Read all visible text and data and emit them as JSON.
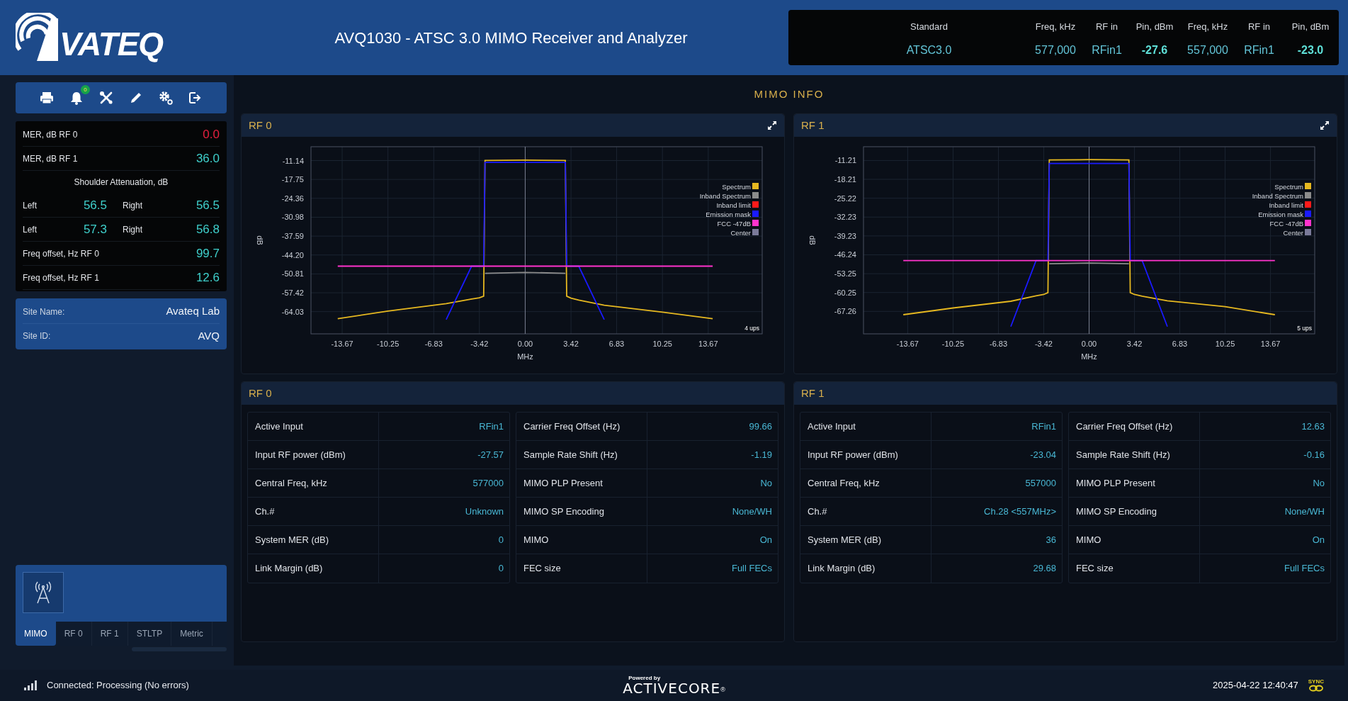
{
  "header": {
    "logo_text": "VATEQ",
    "title": "AVQ1030 - ATSC 3.0 MIMO Receiver and Analyzer",
    "summary": {
      "columns": [
        "Standard",
        "Freq, kHz",
        "RF in",
        "Pin, dBm",
        "Freq, kHz",
        "RF in",
        "Pin, dBm"
      ],
      "values": [
        "ATSC3.0",
        "577,000",
        "RFin1",
        "-27.6",
        "557,000",
        "RFin1",
        "-23.0"
      ]
    }
  },
  "toolbar": {
    "notification_count": "0"
  },
  "metrics": [
    {
      "kind": "single",
      "label": "MER, dB RF 0",
      "value": "0.0",
      "alarm": true
    },
    {
      "kind": "single",
      "label": "MER, dB RF 1",
      "value": "36.0",
      "alarm": false
    },
    {
      "kind": "heading",
      "label": "Shoulder Attenuation, dB"
    },
    {
      "kind": "pair",
      "label": "Left",
      "value": "56.5",
      "label2": "Right",
      "value2": "56.5"
    },
    {
      "kind": "pair",
      "label": "Left",
      "value": "57.3",
      "label2": "Right",
      "value2": "56.8"
    },
    {
      "kind": "single",
      "label": "Freq offset, Hz RF 0",
      "value": "99.7",
      "alarm": false
    },
    {
      "kind": "single",
      "label": "Freq offset, Hz RF 1",
      "value": "12.6",
      "alarm": false
    }
  ],
  "site": [
    {
      "label": "Site Name:",
      "value": "Avateq Lab"
    },
    {
      "label": "Site ID:",
      "value": "AVQ"
    }
  ],
  "nav_tabs": [
    {
      "label": "MIMO",
      "selected": true
    },
    {
      "label": "RF 0",
      "selected": false
    },
    {
      "label": "RF 1",
      "selected": false
    },
    {
      "label": "STLTP",
      "selected": false
    },
    {
      "label": "Metric",
      "selected": false
    }
  ],
  "main_title": "MIMO INFO",
  "spectrum_panels": [
    {
      "title": "RF 0",
      "rate": "4 ups",
      "chart_data": {
        "type": "line",
        "xlabel": "MHz",
        "ylabel": "dB",
        "x": [
          -14,
          -10.25,
          -5.9,
          -4.0,
          -3.42,
          -3.1,
          -3.0,
          0,
          3.0,
          3.1,
          3.42,
          4.0,
          5.9,
          10.25,
          14
        ],
        "series": [
          {
            "name": "Spectrum",
            "color": "#e6b820",
            "values": [
              -66.5,
              -63.8,
              -61.2,
              -59.6,
              -59.2,
              -58.6,
              -11.1,
              -11.0,
              -11.1,
              -58.6,
              -59.3,
              -60.0,
              -61.8,
              -64.2,
              -66.5
            ]
          },
          {
            "name": "Inband Spectrum",
            "color": "#8c8c8c",
            "values": [
              null,
              null,
              null,
              null,
              null,
              null,
              -50.6,
              -50.3,
              -50.6,
              null,
              null,
              null,
              null,
              null,
              null
            ]
          },
          {
            "name": "Inband limit",
            "color": "#ff1a1a",
            "values": [
              null,
              null,
              null,
              null,
              null,
              null,
              null,
              null,
              null,
              null,
              null,
              null,
              null,
              null,
              null
            ]
          },
          {
            "name": "Emission mask",
            "color": "#1a1aff",
            "values": [
              null,
              null,
              -66.8,
              -48.1,
              -48.1,
              -48.1,
              -11.8,
              -11.8,
              -11.8,
              -48.1,
              -48.1,
              -48.1,
              -66.8,
              null,
              null
            ]
          },
          {
            "name": "FCC -47dB",
            "color": "#ff33cc",
            "values": [
              -48.1,
              -48.1,
              -48.1,
              -48.1,
              -48.1,
              -48.1,
              -48.1,
              -48.1,
              -48.1,
              -48.1,
              -48.1,
              -48.1,
              -48.1,
              -48.1,
              -48.1
            ]
          },
          {
            "name": "Center",
            "color": "#7a7a99",
            "values": [
              null,
              null,
              null,
              null,
              null,
              null,
              null,
              null,
              null,
              null,
              null,
              null,
              null,
              null,
              null
            ]
          }
        ],
        "xlim": [
          -16,
          17.7
        ],
        "ylim": [
          -71.8,
          -6.3
        ],
        "grid": true,
        "legend": true,
        "xticks": [
          -13.67,
          -10.25,
          -6.83,
          -3.42,
          {
            "value": 0,
            "label": "0.00"
          },
          3.42,
          6.83,
          10.25,
          13.67
        ],
        "yticks": [
          -11.14,
          -17.75,
          -24.36,
          -30.98,
          -37.59,
          {
            "value": -44.2,
            "label": "-44.20"
          },
          -50.81,
          -57.42,
          -64.03
        ],
        "ref_lines": [
          {
            "axis": "x",
            "value": 0
          }
        ]
      }
    },
    {
      "title": "RF 1",
      "rate": "5 ups",
      "chart_data": {
        "type": "line",
        "xlabel": "MHz",
        "ylabel": "dB",
        "x": [
          -14,
          -10.25,
          -5.9,
          -4.0,
          -3.42,
          -3.1,
          -3.0,
          0,
          3.0,
          3.1,
          3.42,
          4.0,
          5.9,
          10.25,
          14
        ],
        "series": [
          {
            "name": "Spectrum",
            "color": "#e6b820",
            "values": [
              -68.5,
              -66.0,
              -63.5,
              -61.5,
              -61.0,
              -60.3,
              -11.0,
              -10.9,
              -11.0,
              -60.3,
              -61.0,
              -61.6,
              -63.3,
              -65.5,
              -68.5
            ]
          },
          {
            "name": "Inband Spectrum",
            "color": "#8c8c8c",
            "values": [
              null,
              null,
              null,
              null,
              null,
              null,
              -49.6,
              -49.3,
              -49.6,
              null,
              null,
              null,
              null,
              null,
              null
            ]
          },
          {
            "name": "Inband limit",
            "color": "#ff1a1a",
            "values": [
              null,
              null,
              null,
              null,
              null,
              null,
              null,
              null,
              null,
              null,
              null,
              null,
              null,
              null,
              null
            ]
          },
          {
            "name": "Emission mask",
            "color": "#1a1aff",
            "values": [
              null,
              null,
              -72.9,
              -48.4,
              -48.4,
              -48.4,
              -12.3,
              -12.3,
              -12.3,
              -48.4,
              -48.4,
              -48.4,
              -72.9,
              null,
              null
            ]
          },
          {
            "name": "FCC -47dB",
            "color": "#ff33cc",
            "values": [
              -48.4,
              -48.4,
              -48.4,
              -48.4,
              -48.4,
              -48.4,
              -48.4,
              -48.4,
              -48.4,
              -48.4,
              -48.4,
              -48.4,
              -48.4,
              -48.4,
              -48.4
            ]
          },
          {
            "name": "Center",
            "color": "#7a7a99",
            "values": [
              null,
              null,
              null,
              null,
              null,
              null,
              null,
              null,
              null,
              null,
              null,
              null,
              null,
              null,
              null
            ]
          }
        ],
        "xlim": [
          -17,
          17
        ],
        "ylim": [
          -75.6,
          -6.1
        ],
        "grid": true,
        "legend": true,
        "xticks": [
          -13.67,
          -10.25,
          -6.83,
          -3.42,
          {
            "value": 0,
            "label": "0.00"
          },
          3.42,
          6.83,
          10.25,
          13.67
        ],
        "yticks": [
          -11.21,
          -18.21,
          -25.22,
          -32.23,
          -39.23,
          -46.24,
          -53.25,
          -60.25,
          -67.26
        ],
        "ref_lines": [
          {
            "axis": "x",
            "value": 0
          }
        ]
      }
    }
  ],
  "info_panels": [
    {
      "title": "RF 0",
      "left": [
        {
          "label": "Active Input",
          "value": "RFin1"
        },
        {
          "label": "Input RF power (dBm)",
          "value": "-27.57"
        },
        {
          "label": "Central Freq, kHz",
          "value": "577000"
        },
        {
          "label": "Ch.#",
          "value": "Unknown"
        },
        {
          "label": "System MER (dB)",
          "value": "0"
        },
        {
          "label": "Link Margin (dB)",
          "value": "0"
        }
      ],
      "right": [
        {
          "label": "Carrier Freq Offset (Hz)",
          "value": "99.66"
        },
        {
          "label": "Sample Rate Shift (Hz)",
          "value": "-1.19"
        },
        {
          "label": "MIMO PLP Present",
          "value": "No"
        },
        {
          "label": "MIMO SP Encoding",
          "value": "None/WH"
        },
        {
          "label": "MIMO",
          "value": "On"
        },
        {
          "label": "FEC size",
          "value": "Full FECs"
        }
      ]
    },
    {
      "title": "RF 1",
      "left": [
        {
          "label": "Active Input",
          "value": "RFin1"
        },
        {
          "label": "Input RF power (dBm)",
          "value": "-23.04"
        },
        {
          "label": "Central Freq, kHz",
          "value": "557000"
        },
        {
          "label": "Ch.#",
          "value": "Ch.28 <557MHz>"
        },
        {
          "label": "System MER (dB)",
          "value": "36"
        },
        {
          "label": "Link Margin (dB)",
          "value": "29.68"
        }
      ],
      "right": [
        {
          "label": "Carrier Freq Offset (Hz)",
          "value": "12.63"
        },
        {
          "label": "Sample Rate Shift (Hz)",
          "value": "-0.16"
        },
        {
          "label": "MIMO PLP Present",
          "value": "No"
        },
        {
          "label": "MIMO SP Encoding",
          "value": "None/WH"
        },
        {
          "label": "MIMO",
          "value": "On"
        },
        {
          "label": "FEC size",
          "value": "Full FECs"
        }
      ]
    }
  ],
  "status_bar": {
    "connection": "Connected: Processing (No errors)",
    "powered_by": "Powered by",
    "brand": "ACTIVECORE",
    "trademark": "®",
    "datetime": "2025-04-22 12:40:47",
    "sync": "SYNC"
  }
}
